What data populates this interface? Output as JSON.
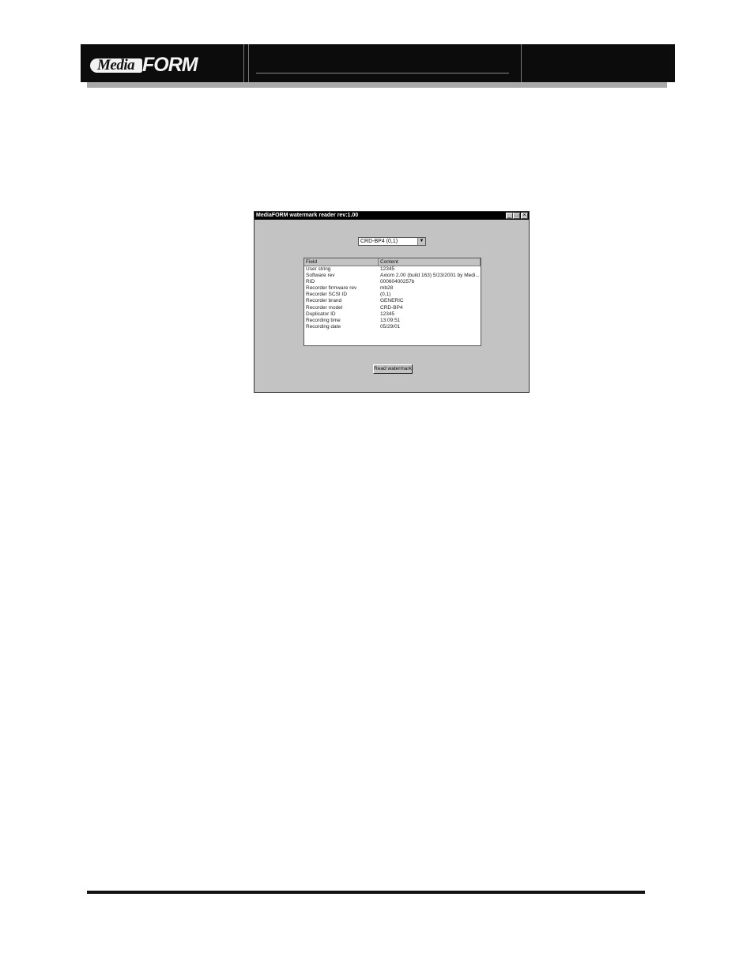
{
  "header": {
    "logo_media": "Media",
    "logo_form": "FORM"
  },
  "dialog": {
    "title": "MediaFORM watermark reader rev:1.00",
    "titlebar_buttons": [
      "minimize-icon",
      "maximize-icon",
      "close-icon"
    ],
    "drive_select_value": "CRD-BP4 (0,1)",
    "columns": [
      "Field",
      "Content"
    ],
    "rows": [
      {
        "field": "User string",
        "content": "12345"
      },
      {
        "field": "Software rev",
        "content": "Axiom 2.00 (build 163) 5/23/2001 by Medi..."
      },
      {
        "field": "RID",
        "content": "00060400257b"
      },
      {
        "field": "Recorder firmware rev",
        "content": "mb28"
      },
      {
        "field": "Recorder SCSI ID",
        "content": "(0,1)"
      },
      {
        "field": "Recorder brand",
        "content": "GENERIC"
      },
      {
        "field": "Recorder model",
        "content": "CRD-BP4"
      },
      {
        "field": "Duplicator ID",
        "content": "12345"
      },
      {
        "field": "Recording time",
        "content": "13:09:51"
      },
      {
        "field": "Recording date",
        "content": "05/29/01"
      }
    ],
    "read_button_label": "Read watermark"
  }
}
